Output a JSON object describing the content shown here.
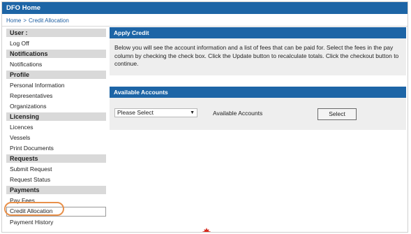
{
  "header": {
    "title": "DFO Home"
  },
  "breadcrumb": {
    "home": "Home",
    "separator": ">",
    "current": "Credit Allocation"
  },
  "sidebar": {
    "sections": [
      {
        "title": "User :",
        "items": [
          "Log Off"
        ]
      },
      {
        "title": "Notifications",
        "items": [
          "Notifications"
        ]
      },
      {
        "title": "Profile",
        "items": [
          "Personal Information",
          "Representatives",
          "Organizations"
        ]
      },
      {
        "title": "Licensing",
        "items": [
          "Licences",
          "Vessels",
          "Print Documents"
        ]
      },
      {
        "title": "Requests",
        "items": [
          "Submit Request",
          "Request Status"
        ]
      },
      {
        "title": "Payments",
        "items": [
          "Pay Fees",
          "Credit Allocation",
          "Payment History"
        ]
      }
    ],
    "active_item": "Credit Allocation"
  },
  "apply_credit": {
    "title": "Apply Credit",
    "text": "Below you will see the account information and a list of fees that can be paid for. Select the fees in the pay column by checking the check box. Click the Update button to recalculate totals. Click the checkout button to continue."
  },
  "available_accounts": {
    "title": "Available Accounts",
    "select_value": "Please Select",
    "label": "Available Accounts",
    "button_label": "Select"
  },
  "colors": {
    "accent": "#1d65a6",
    "highlight": "#e8904a",
    "section": "#d9d9d9",
    "panel": "#eeeeee",
    "logo": "#d52b1e"
  },
  "icons": {
    "logo": "maple-leaf-icon",
    "dropdown": "chevron-down-icon"
  }
}
